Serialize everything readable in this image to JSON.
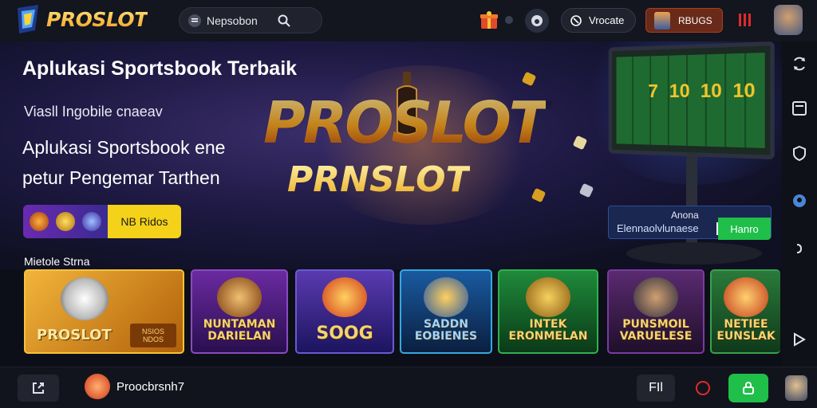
{
  "header": {
    "logo_text": "PROSLOT",
    "search_label": "Nepsobon",
    "pill_label": "Vrocate",
    "account_label": "RBUGS"
  },
  "hero": {
    "title": "Aplukasi Sportsbook Terbaik",
    "subtitle": "Viasll Ingobile cnaeav",
    "body_line1": "Aplukasi Sportsbook ene",
    "body_line2": "petur Pengemar Tarthen",
    "promo_label": "NB Ridos",
    "brand_main": "PROSLOT",
    "brand_sub": "PRNSLOT",
    "monitor_numbers": [
      "7",
      "10",
      "10",
      "10"
    ],
    "cta_line1": "Anona",
    "cta_line2": "Elennaolvlunaese",
    "cta_button": "Hanro"
  },
  "games": {
    "section_title": "Mietole Strna",
    "items": [
      {
        "title": "PROSLOT",
        "badge": "NSIOS NDOS",
        "bg": "#d58a16"
      },
      {
        "title": "NUNTAMAN DARIELAN",
        "bg": "#4a1f7a"
      },
      {
        "title": "SOOG",
        "bg": "#3b2a8a"
      },
      {
        "title": "SADDN EOBIENES",
        "bg": "#0f3f6a"
      },
      {
        "title": "INTEK ERONMELAN",
        "bg": "#0f5a2a"
      },
      {
        "title": "PUNSMOIL VARUELESE",
        "bg": "#3a1a4a"
      },
      {
        "title": "NETIEE EUNSLAK",
        "bg": "#1a4a22"
      }
    ]
  },
  "bottom": {
    "brand_label": "Proocbrsnh7",
    "fi_label": "FIl"
  },
  "colors": {
    "accent_gold": "#f5a21f",
    "accent_green": "#1fbf4a",
    "accent_red": "#e02a2a",
    "promo_yellow": "#f5d21a"
  }
}
